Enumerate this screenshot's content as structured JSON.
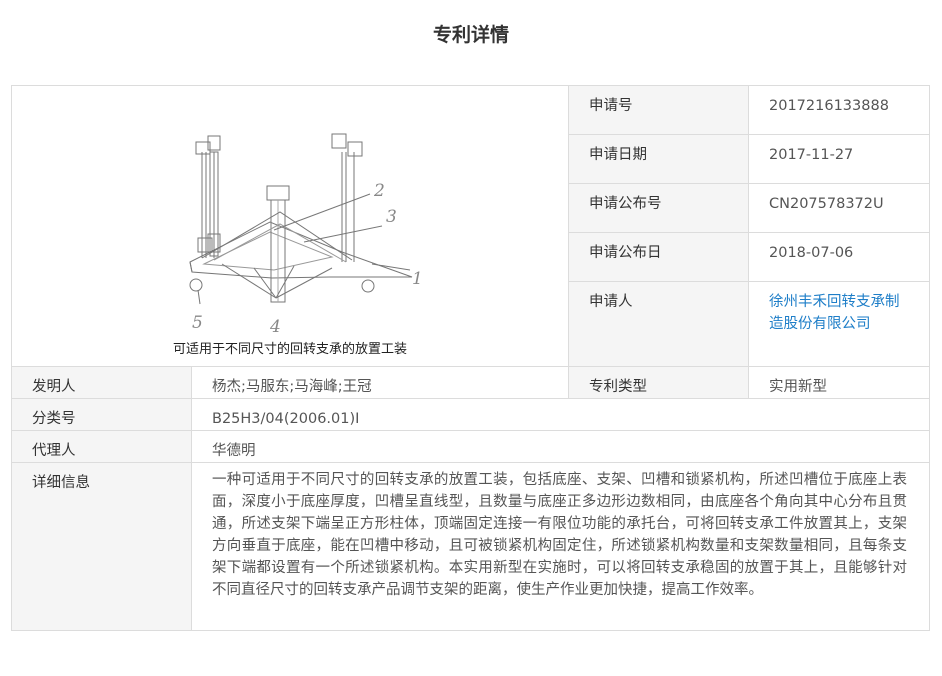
{
  "page": {
    "title": "专利详情"
  },
  "patent": {
    "drawing_caption": "可适用于不同尺寸的回转支承的放置工装",
    "drawing_callouts": [
      "1",
      "2",
      "3",
      "4",
      "5"
    ],
    "application_no": {
      "label": "申请号",
      "value": "2017216133888"
    },
    "application_date": {
      "label": "申请日期",
      "value": "2017-11-27"
    },
    "publication_no": {
      "label": "申请公布号",
      "value": "CN207578372U"
    },
    "publication_date": {
      "label": "申请公布日",
      "value": "2018-07-06"
    },
    "applicant": {
      "label": "申请人",
      "value": "徐州丰禾回转支承制造股份有限公司"
    },
    "inventors": {
      "label": "发明人",
      "value": "杨杰;马服东;马海峰;王冠"
    },
    "patent_type": {
      "label": "专利类型",
      "value": "实用新型"
    },
    "classification": {
      "label": "分类号",
      "value": "B25H3/04(2006.01)I"
    },
    "agent": {
      "label": "代理人",
      "value": "华德明"
    },
    "details": {
      "label": "详细信息",
      "value": "一种可适用于不同尺寸的回转支承的放置工装，包括底座、支架、凹槽和锁紧机构，所述凹槽位于底座上表面，深度小于底座厚度，凹槽呈直线型，且数量与底座正多边形边数相同，由底座各个角向其中心分布且贯通，所述支架下端呈正方形柱体，顶端固定连接一有限位功能的承托台，可将回转支承工件放置其上，支架方向垂直于底座，能在凹槽中移动，且可被锁紧机构固定住，所述锁紧机构数量和支架数量相同，且每条支架下端都设置有一个所述锁紧机构。本实用新型在实施时，可以将回转支承稳固的放置于其上，且能够针对不同直径尺寸的回转支承产品调节支架的距离，使生产作业更加快捷，提高工作效率。"
    }
  }
}
